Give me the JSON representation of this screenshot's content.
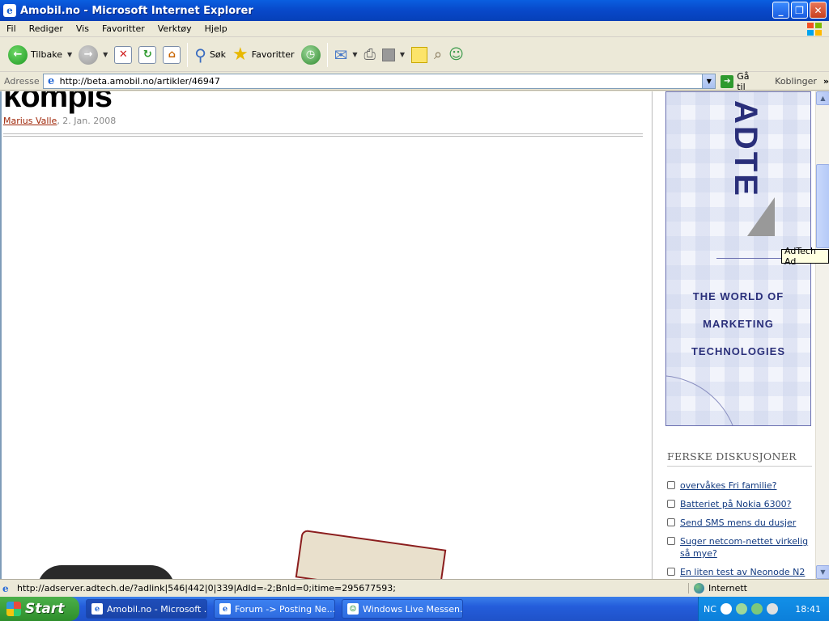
{
  "window": {
    "title": "Amobil.no - Microsoft Internet Explorer"
  },
  "menu": [
    "Fil",
    "Rediger",
    "Vis",
    "Favoritter",
    "Verktøy",
    "Hjelp"
  ],
  "toolbar": {
    "back_label": "Tilbake",
    "search_label": "Søk",
    "favorites_label": "Favoritter"
  },
  "address": {
    "label": "Adresse",
    "url": "http://beta.amobil.no/artikler/46947",
    "go_label": "Gå til",
    "links_label": "Koblinger"
  },
  "article": {
    "title_fragment": "kompis",
    "author": "Marius Valle",
    "date": ", 2. Jan. 2008"
  },
  "ad": {
    "logo": "ADTE",
    "line1": "THE WORLD OF",
    "line2": "MARKETING",
    "line3": "TECHNOLOGIES",
    "tooltip": "AdTech Ad",
    "colors": {
      "brand": "#2A2F7A"
    }
  },
  "discussions": {
    "heading": "FERSKE DISKUSJONER",
    "items": [
      "overvåkes Fri familie?",
      "Batteriet på Nokia 6300?",
      "Send SMS mens du dusjer",
      "Suger netcom-nettet virkelig så mye?",
      "En liten test av Neonode N2"
    ]
  },
  "status": {
    "text": "http://adserver.adtech.de/?adlink|546|442|0|339|AdId=-2;BnId=0;itime=295677593;",
    "zone": "Internett"
  },
  "taskbar": {
    "start": "Start",
    "tasks": [
      "Amobil.no - Microsoft ...",
      "Forum -> Posting Ne...",
      "Windows Live Messen..."
    ],
    "tray_lang": "NC",
    "clock": "18:41"
  }
}
